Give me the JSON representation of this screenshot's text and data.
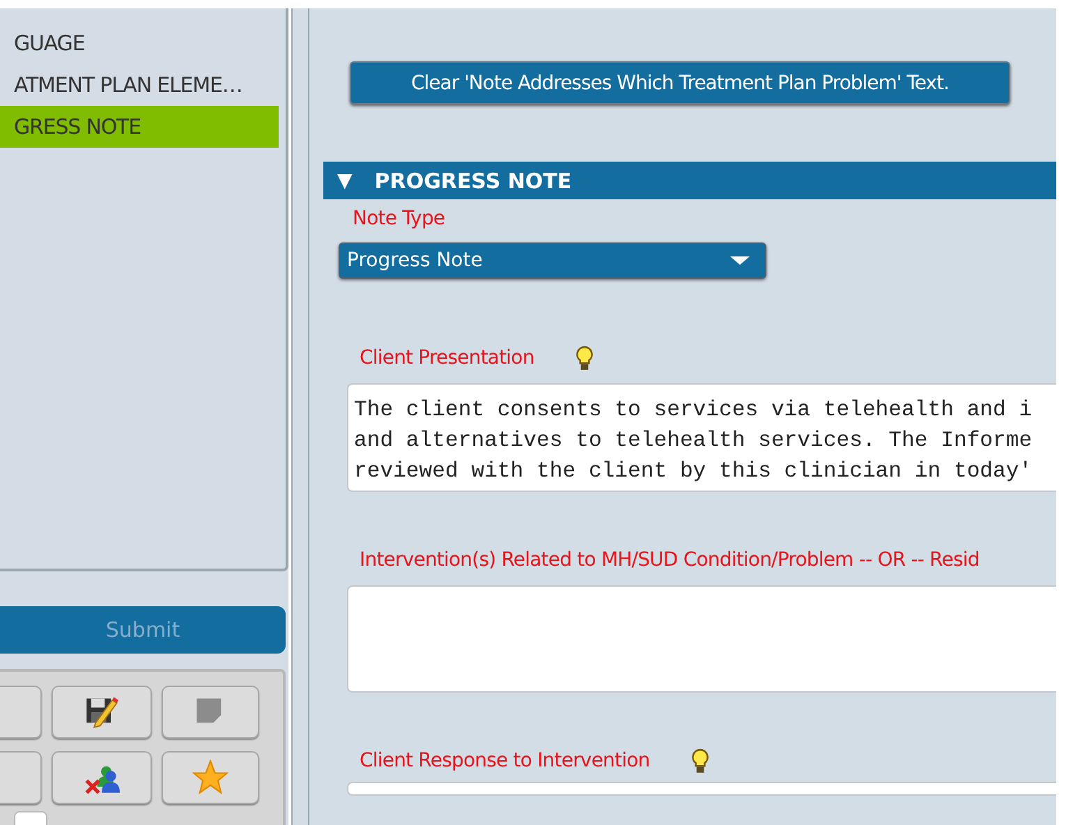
{
  "sidebar": {
    "items": [
      {
        "label": "GUAGE",
        "selected": false
      },
      {
        "label": "ATMENT PLAN ELEME…",
        "selected": false
      },
      {
        "label": "GRESS NOTE",
        "selected": true
      }
    ]
  },
  "submit_button": {
    "label": "Submit"
  },
  "toolbar": {
    "buttons": [
      {
        "kind": "blank"
      },
      {
        "kind": "edit-document"
      },
      {
        "kind": "note"
      },
      {
        "kind": "blank"
      },
      {
        "kind": "remove-users"
      },
      {
        "kind": "favorite"
      }
    ]
  },
  "clear_button": {
    "label": "Clear 'Note Addresses Which Treatment Plan Problem' Text."
  },
  "section": {
    "title": "PROGRESS NOTE",
    "toggle": "▼",
    "expanded": true,
    "fields": [
      {
        "kind": "dropdown",
        "label": "Note Type",
        "value": "Progress Note",
        "hint": false
      },
      {
        "kind": "textarea",
        "label": "Client Presentation",
        "hint": true,
        "value": "The client consents to services via telehealth and i\nand alternatives to telehealth services. The Informe\nreviewed with the client by this clinician in today'"
      },
      {
        "kind": "textarea",
        "label": "Intervention(s) Related to MH/SUD Condition/Problem -- OR -- Resid",
        "hint": false
      },
      {
        "kind": "textarea-partial",
        "label": "Client Response to Intervention",
        "hint": true
      }
    ]
  }
}
